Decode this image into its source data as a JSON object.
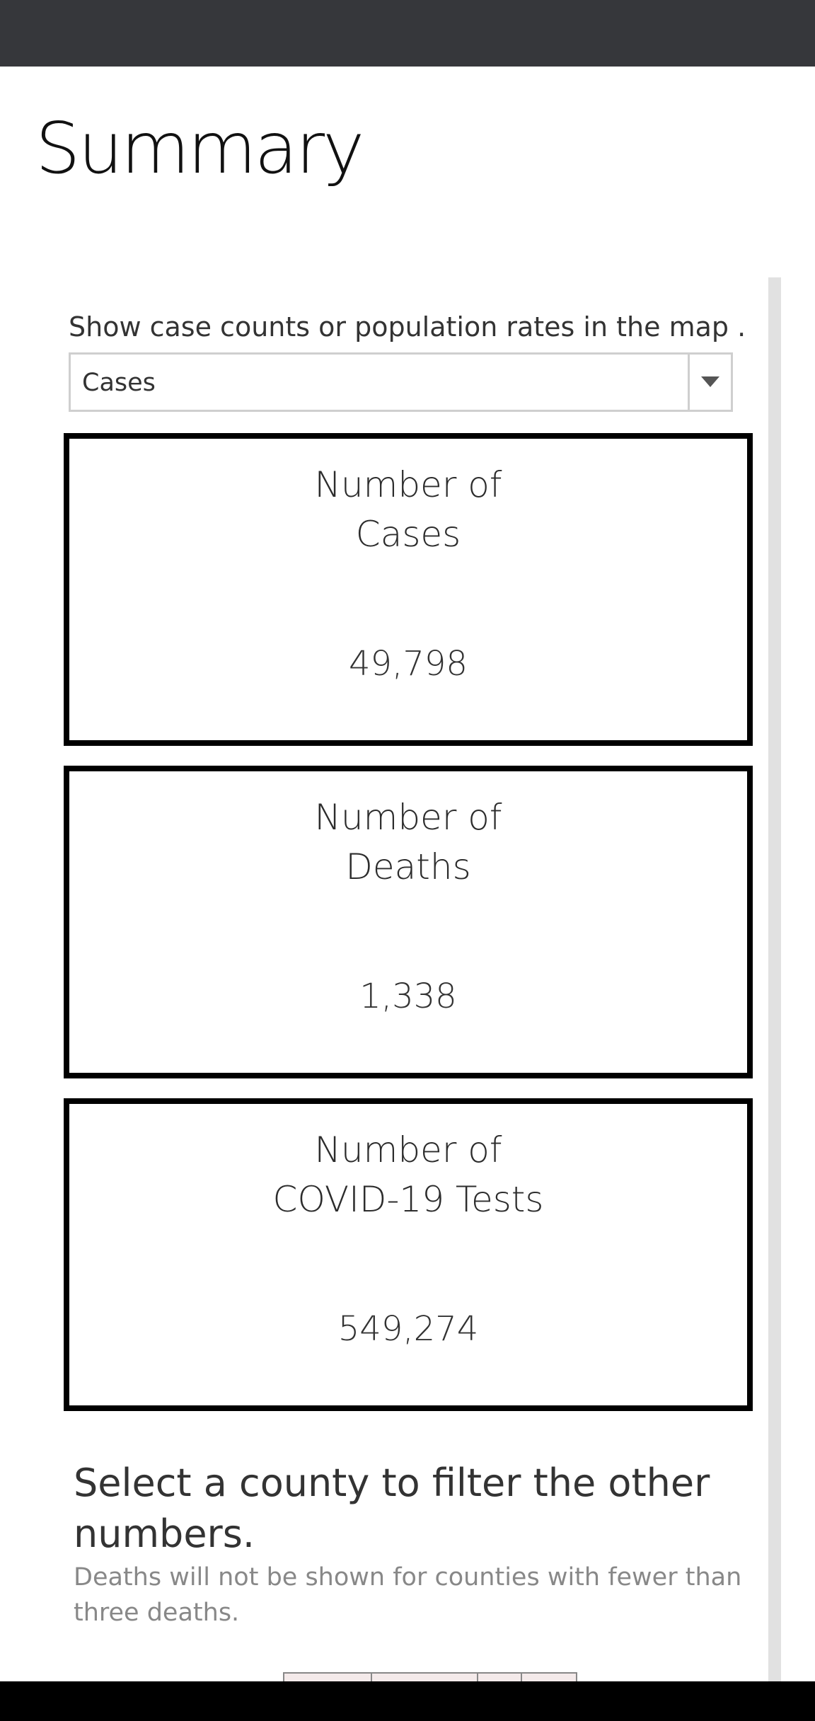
{
  "page": {
    "title": "Summary"
  },
  "parameter": {
    "label": "Show case counts or population rates in the map ...",
    "selected": "Cases"
  },
  "cards": [
    {
      "title_line1": "Number of",
      "title_line2": "Cases",
      "value": "49,798"
    },
    {
      "title_line1": "Number of",
      "title_line2": "Deaths",
      "value": "1,338"
    },
    {
      "title_line1": "Number of",
      "title_line2": "COVID-19 Tests",
      "value": "549,274"
    }
  ],
  "map_section": {
    "heading": "Select a county to filter the other numbers.",
    "note": "Deaths will not be shown for counties with fewer than three deaths."
  },
  "colors": {
    "topbar": "#36373b",
    "card_border": "#000000",
    "scrollbar": "#e1e1e1"
  }
}
